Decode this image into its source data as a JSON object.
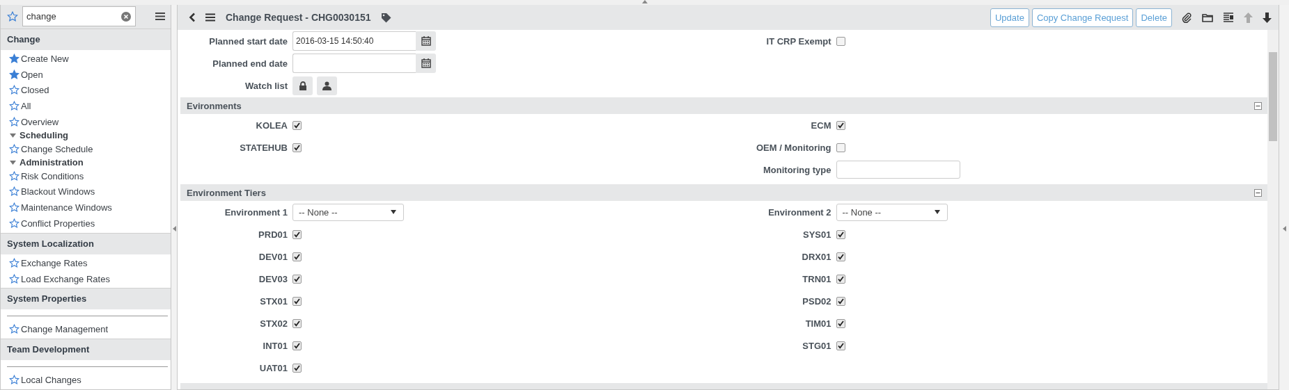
{
  "sidebar": {
    "search": {
      "value": "change"
    },
    "sections": [
      {
        "title": "Change",
        "items": [
          {
            "kind": "item",
            "label": "Create New",
            "starred": true
          },
          {
            "kind": "item",
            "label": "Open",
            "starred": true
          },
          {
            "kind": "item",
            "label": "Closed",
            "starred": false
          },
          {
            "kind": "item",
            "label": "All",
            "starred": false
          },
          {
            "kind": "item",
            "label": "Overview",
            "starred": false
          },
          {
            "kind": "group",
            "label": "Scheduling",
            "expanded": true,
            "children": [
              {
                "kind": "item",
                "label": "Change Schedule",
                "starred": false
              }
            ]
          },
          {
            "kind": "group",
            "label": "Administration",
            "expanded": true,
            "children": [
              {
                "kind": "item",
                "label": "Risk Conditions",
                "starred": false
              },
              {
                "kind": "item",
                "label": "Blackout Windows",
                "starred": false
              },
              {
                "kind": "item",
                "label": "Maintenance Windows",
                "starred": false
              },
              {
                "kind": "item",
                "label": "Conflict Properties",
                "starred": false
              }
            ]
          }
        ]
      },
      {
        "title": "System Localization",
        "items": [
          {
            "kind": "item",
            "label": "Exchange Rates",
            "starred": false
          },
          {
            "kind": "item",
            "label": "Load Exchange Rates",
            "starred": false
          }
        ]
      },
      {
        "title": "System Properties",
        "items": [
          {
            "kind": "divider"
          },
          {
            "kind": "item",
            "label": "Change Management",
            "starred": false
          }
        ]
      },
      {
        "title": "Team Development",
        "items": [
          {
            "kind": "divider"
          },
          {
            "kind": "item",
            "label": "Local Changes",
            "starred": false
          }
        ]
      }
    ]
  },
  "header": {
    "title": "Change Request - CHG0030151",
    "buttons": [
      "Update",
      "Copy Change Request",
      "Delete"
    ]
  },
  "form": {
    "sections": [
      {
        "left": [
          {
            "kind": "date",
            "label": "Planned start date",
            "value": "2016-03-15 14:50:40"
          },
          {
            "kind": "date",
            "label": "Planned end date"
          },
          {
            "kind": "watchlist",
            "label": "Watch list"
          }
        ],
        "right": [
          {
            "kind": "checkbox",
            "label": "IT CRP Exempt",
            "checked": false
          }
        ]
      },
      {
        "title": "Evironments",
        "left": [
          {
            "kind": "checkbox",
            "label": "KOLEA",
            "checked": true
          },
          {
            "kind": "checkbox",
            "label": "STATEHUB",
            "checked": true
          }
        ],
        "right": [
          {
            "kind": "checkbox",
            "label": "ECM",
            "checked": true
          },
          {
            "kind": "checkbox",
            "label": "OEM / Monitoring",
            "checked": false
          },
          {
            "kind": "text",
            "label": "Monitoring type"
          }
        ]
      },
      {
        "title": "Environment Tiers",
        "left": [
          {
            "kind": "select",
            "label": "Environment 1",
            "value": "-- None --"
          },
          {
            "kind": "checkbox",
            "label": "PRD01",
            "checked": true
          },
          {
            "kind": "checkbox",
            "label": "DEV01",
            "checked": true
          },
          {
            "kind": "checkbox",
            "label": "DEV03",
            "checked": true
          },
          {
            "kind": "checkbox",
            "label": "STX01",
            "checked": true
          },
          {
            "kind": "checkbox",
            "label": "STX02",
            "checked": true
          },
          {
            "kind": "checkbox",
            "label": "INT01",
            "checked": true
          },
          {
            "kind": "checkbox",
            "label": "UAT01",
            "checked": true
          }
        ],
        "right": [
          {
            "kind": "select",
            "label": "Environment 2",
            "value": "-- None --"
          },
          {
            "kind": "checkbox",
            "label": "SYS01",
            "checked": true
          },
          {
            "kind": "checkbox",
            "label": "DRX01",
            "checked": true
          },
          {
            "kind": "checkbox",
            "label": "TRN01",
            "checked": true
          },
          {
            "kind": "checkbox",
            "label": "PSD02",
            "checked": true
          },
          {
            "kind": "checkbox",
            "label": "TIM01",
            "checked": true
          },
          {
            "kind": "checkbox",
            "label": "STG01",
            "checked": true
          }
        ]
      }
    ]
  }
}
